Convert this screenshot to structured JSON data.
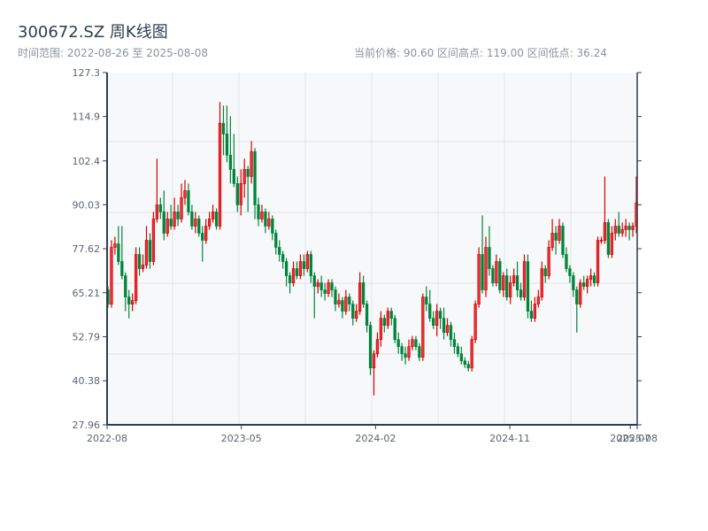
{
  "header": {
    "title": "300672.SZ 周K线图",
    "range_text": "时间范围: 2022-08-26 至 2025-08-08",
    "stats_text": "当前价格: 90.60  区间高点: 119.00  区间低点: 36.24"
  },
  "chart_data": {
    "type": "candlestick",
    "title": "300672.SZ 周K线图",
    "start_date": "2022-08-26",
    "end_date": "2025-08-08",
    "frequency": "weekly",
    "current_price": 90.6,
    "range_high": 119.0,
    "range_low": 36.24,
    "ylim": [
      27.96,
      127.3
    ],
    "y_ticks": [
      "27.96",
      "40.38",
      "52.79",
      "65.21",
      "77.62",
      "90.03",
      "102.4",
      "114.9",
      "127.3"
    ],
    "x_ticks": [
      {
        "label": "2022-08",
        "date": "2022-08-26"
      },
      {
        "label": "2023-05",
        "date": "2023-05-26"
      },
      {
        "label": "2024-02",
        "date": "2024-02-23"
      },
      {
        "label": "2024-11",
        "date": "2024-11-22"
      },
      {
        "label": "2025-07",
        "date": "2025-07-25"
      },
      {
        "label": "2025-08",
        "date": "2025-08-08"
      }
    ],
    "grid": true,
    "colors": {
      "up": "#d40000",
      "up_fill": "#e8333a",
      "down": "#00853b",
      "axis": "#2c3e50",
      "plot_bg": "#f7f8fa",
      "grid": "#e1e4e9"
    },
    "ohlc_fields": [
      "open",
      "high",
      "low",
      "close"
    ],
    "ohlc": [
      [
        66,
        67,
        61,
        62
      ],
      [
        62,
        80,
        61,
        78
      ],
      [
        78,
        81,
        76,
        79
      ],
      [
        79,
        84,
        73,
        74
      ],
      [
        74,
        84,
        69,
        70
      ],
      [
        70,
        71,
        60,
        64
      ],
      [
        64,
        66,
        58,
        62
      ],
      [
        62,
        65,
        60,
        63
      ],
      [
        63,
        78,
        62,
        76
      ],
      [
        76,
        78,
        70,
        72
      ],
      [
        72,
        76,
        71,
        73
      ],
      [
        73,
        84,
        72,
        80
      ],
      [
        80,
        82,
        72,
        74
      ],
      [
        74,
        88,
        73,
        86
      ],
      [
        86,
        103,
        85,
        90
      ],
      [
        90,
        92,
        86,
        88
      ],
      [
        88,
        94,
        80,
        82
      ],
      [
        82,
        88,
        81,
        86
      ],
      [
        86,
        90,
        83,
        84
      ],
      [
        84,
        92,
        83,
        88
      ],
      [
        88,
        90,
        84,
        86
      ],
      [
        86,
        96,
        85,
        92
      ],
      [
        92,
        97,
        90,
        94
      ],
      [
        94,
        96,
        87,
        88
      ],
      [
        88,
        90,
        83,
        84
      ],
      [
        84,
        88,
        82,
        86
      ],
      [
        86,
        87,
        81,
        82
      ],
      [
        82,
        84,
        74,
        80
      ],
      [
        80,
        86,
        79,
        84
      ],
      [
        84,
        88,
        83,
        86
      ],
      [
        86,
        90,
        85,
        88
      ],
      [
        88,
        89,
        83,
        84
      ],
      [
        84,
        119,
        83,
        113
      ],
      [
        113,
        118,
        104,
        110
      ],
      [
        110,
        118,
        102,
        104
      ],
      [
        104,
        115,
        96,
        100
      ],
      [
        100,
        110,
        95,
        96
      ],
      [
        96,
        98,
        88,
        90
      ],
      [
        90,
        100,
        87,
        96
      ],
      [
        96,
        103,
        92,
        100
      ],
      [
        100,
        101,
        88,
        98
      ],
      [
        98,
        108,
        96,
        105
      ],
      [
        105,
        106,
        86,
        90
      ],
      [
        90,
        92,
        84,
        86
      ],
      [
        86,
        90,
        85,
        88
      ],
      [
        88,
        89,
        82,
        84
      ],
      [
        84,
        88,
        83,
        86
      ],
      [
        86,
        87,
        80,
        82
      ],
      [
        82,
        83,
        76,
        78
      ],
      [
        78,
        80,
        74,
        76
      ],
      [
        76,
        77,
        72,
        74
      ],
      [
        74,
        75,
        67,
        70
      ],
      [
        70,
        71,
        65,
        68
      ],
      [
        68,
        74,
        67,
        72
      ],
      [
        72,
        74,
        69,
        70
      ],
      [
        70,
        76,
        69,
        74
      ],
      [
        74,
        76,
        70,
        72
      ],
      [
        72,
        77,
        71,
        76
      ],
      [
        76,
        77,
        68,
        70
      ],
      [
        70,
        71,
        58,
        67
      ],
      [
        67,
        69,
        65,
        68
      ],
      [
        68,
        70,
        64,
        66
      ],
      [
        66,
        68,
        63,
        65
      ],
      [
        65,
        69,
        64,
        68
      ],
      [
        68,
        69,
        64,
        66
      ],
      [
        66,
        67,
        60,
        62
      ],
      [
        62,
        65,
        61,
        63
      ],
      [
        63,
        64,
        58,
        60
      ],
      [
        60,
        66,
        59,
        64
      ],
      [
        64,
        65,
        60,
        62
      ],
      [
        62,
        63,
        56,
        58
      ],
      [
        58,
        62,
        57,
        60
      ],
      [
        60,
        71,
        59,
        68
      ],
      [
        68,
        70,
        61,
        62
      ],
      [
        62,
        63,
        54,
        56
      ],
      [
        56,
        57,
        42,
        44
      ],
      [
        44,
        49,
        36.24,
        48
      ],
      [
        48,
        54,
        47,
        52
      ],
      [
        52,
        60,
        50,
        58
      ],
      [
        58,
        59,
        54,
        56
      ],
      [
        56,
        61,
        55,
        60
      ],
      [
        60,
        61,
        56,
        58
      ],
      [
        58,
        59,
        51,
        52
      ],
      [
        52,
        54,
        48,
        50
      ],
      [
        50,
        51,
        46,
        48
      ],
      [
        48,
        50,
        45,
        47
      ],
      [
        47,
        52,
        46,
        50
      ],
      [
        50,
        53,
        49,
        52
      ],
      [
        52,
        53,
        49,
        50
      ],
      [
        50,
        51,
        46,
        47
      ],
      [
        47,
        65,
        46,
        64
      ],
      [
        64,
        67,
        60,
        62
      ],
      [
        62,
        66,
        57,
        58
      ],
      [
        58,
        60,
        55,
        56
      ],
      [
        56,
        62,
        53,
        60
      ],
      [
        60,
        61,
        55,
        58
      ],
      [
        58,
        61,
        52,
        54
      ],
      [
        54,
        58,
        53,
        56
      ],
      [
        56,
        57,
        50,
        52
      ],
      [
        52,
        54,
        48,
        50
      ],
      [
        50,
        51,
        47,
        48
      ],
      [
        48,
        50,
        45,
        46
      ],
      [
        46,
        47,
        44,
        45
      ],
      [
        45,
        46,
        43,
        44
      ],
      [
        44,
        53,
        43,
        52
      ],
      [
        52,
        63,
        51,
        62
      ],
      [
        62,
        78,
        61,
        76
      ],
      [
        76,
        87,
        65,
        66
      ],
      [
        66,
        81,
        64,
        78
      ],
      [
        78,
        84,
        70,
        72
      ],
      [
        72,
        73,
        67,
        68
      ],
      [
        68,
        76,
        67,
        74
      ],
      [
        74,
        75,
        65,
        66
      ],
      [
        66,
        71,
        64,
        70
      ],
      [
        70,
        72,
        63,
        64
      ],
      [
        64,
        70,
        62,
        68
      ],
      [
        68,
        72,
        67,
        70
      ],
      [
        70,
        74,
        64,
        66
      ],
      [
        66,
        68,
        63,
        64
      ],
      [
        64,
        76,
        63,
        74
      ],
      [
        74,
        76,
        58,
        60
      ],
      [
        60,
        63,
        57,
        58
      ],
      [
        58,
        64,
        57,
        62
      ],
      [
        62,
        66,
        61,
        64
      ],
      [
        64,
        74,
        63,
        72
      ],
      [
        72,
        73,
        68,
        70
      ],
      [
        70,
        80,
        69,
        78
      ],
      [
        78,
        86,
        77,
        82
      ],
      [
        82,
        84,
        76,
        80
      ],
      [
        80,
        86,
        79,
        84
      ],
      [
        84,
        85,
        75,
        76
      ],
      [
        76,
        78,
        71,
        72
      ],
      [
        72,
        73,
        68,
        70
      ],
      [
        70,
        71,
        64,
        66
      ],
      [
        66,
        67,
        54,
        62
      ],
      [
        62,
        69,
        61,
        68
      ],
      [
        68,
        70,
        66,
        67
      ],
      [
        67,
        70,
        65,
        69
      ],
      [
        69,
        72,
        67,
        70
      ],
      [
        70,
        71,
        67,
        68
      ],
      [
        68,
        81,
        67,
        80
      ],
      [
        80,
        81,
        79,
        80
      ],
      [
        80,
        98,
        79,
        85
      ],
      [
        85,
        86,
        75,
        76
      ],
      [
        76,
        84,
        75,
        82
      ],
      [
        82,
        86,
        80,
        84
      ],
      [
        84,
        88,
        81,
        82
      ],
      [
        82,
        85,
        81,
        83
      ],
      [
        83,
        86,
        81,
        84
      ],
      [
        84,
        85,
        80,
        83
      ],
      [
        83,
        85,
        81,
        84
      ],
      [
        84,
        98,
        82,
        90.6
      ]
    ]
  }
}
